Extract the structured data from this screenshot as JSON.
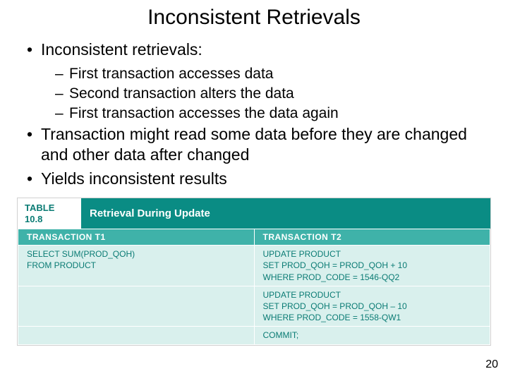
{
  "title": "Inconsistent Retrievals",
  "bullets": [
    {
      "level": 1,
      "text": "Inconsistent retrievals:"
    },
    {
      "level": 2,
      "text": "First transaction accesses data"
    },
    {
      "level": 2,
      "text": "Second transaction alters the data"
    },
    {
      "level": 2,
      "text": "First transaction accesses the data again"
    },
    {
      "level": 1,
      "text": "Transaction might read some data before they are changed and other data after changed"
    },
    {
      "level": 1,
      "text": "Yields inconsistent results"
    }
  ],
  "table": {
    "label": "TABLE\n10.8",
    "caption": "Retrieval During Update",
    "headers": [
      "TRANSACTION T1",
      "TRANSACTION T2"
    ],
    "rows": [
      [
        "SELECT SUM(PROD_QOH)\nFROM PRODUCT",
        "UPDATE PRODUCT\nSET PROD_QOH = PROD_QOH + 10\nWHERE PROD_CODE = 1546-QQ2"
      ],
      [
        "",
        "UPDATE PRODUCT\nSET PROD_QOH = PROD_QOH – 10\nWHERE PROD_CODE = 1558-QW1"
      ],
      [
        "",
        "COMMIT;"
      ]
    ]
  },
  "page_number": "20"
}
